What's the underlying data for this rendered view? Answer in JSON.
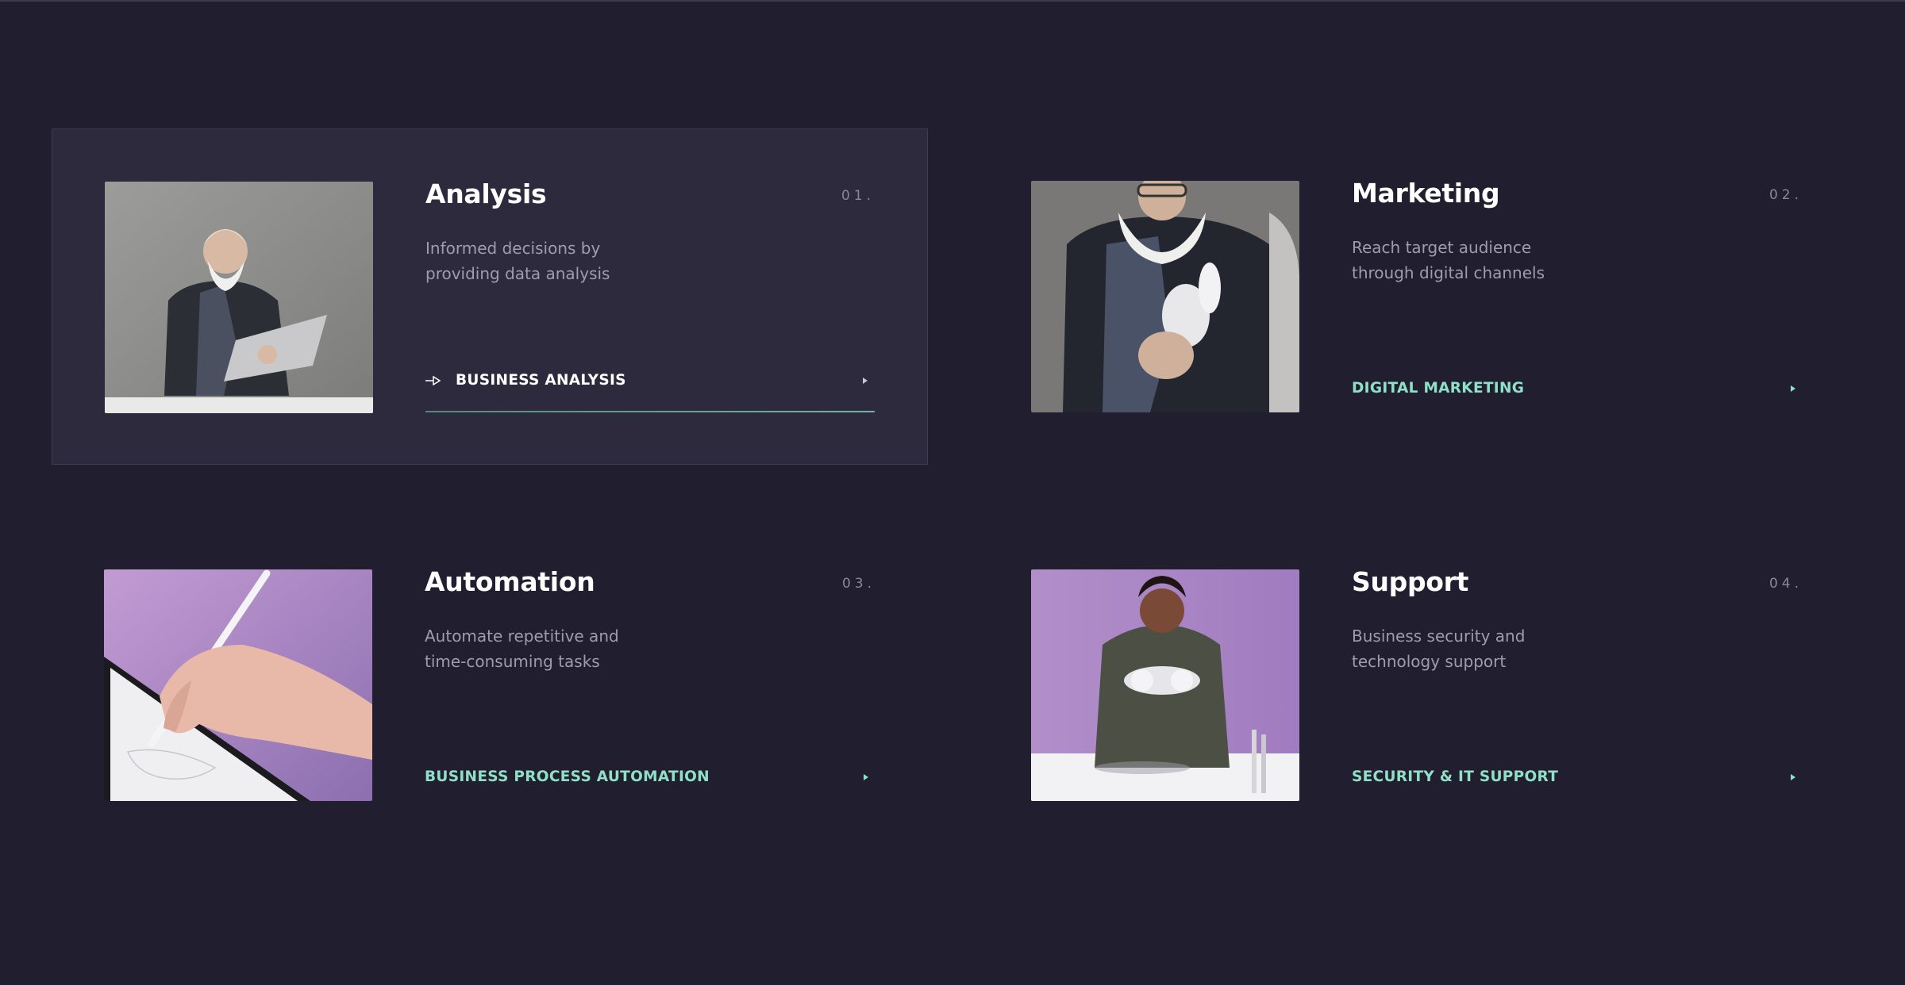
{
  "cards": [
    {
      "title": "Analysis",
      "number": "01.",
      "desc_line1": "Informed decisions by",
      "desc_line2": "providing data analysis",
      "link": "BUSINESS ANALYSIS",
      "photo": "man-with-tablet-photo"
    },
    {
      "title": "Marketing",
      "number": "02.",
      "desc_line1": "Reach target audience",
      "desc_line2": "through digital channels",
      "link": "DIGITAL MARKETING",
      "photo": "man-with-headphones-photo"
    },
    {
      "title": "Automation",
      "number": "03.",
      "desc_line1": "Automate repetitive and",
      "desc_line2": "time-consuming tasks",
      "link": "BUSINESS PROCESS AUTOMATION",
      "photo": "hand-with-stylus-photo"
    },
    {
      "title": "Support",
      "number": "04.",
      "desc_line1": "Business security and",
      "desc_line2": "technology support",
      "link": "SECURITY & IT SUPPORT",
      "photo": "woman-with-headphones-photo"
    }
  ],
  "colors": {
    "background": "#201e2f",
    "card_active": "#2d2a3d",
    "accent": "#8fe0c7",
    "title": "#ffffff",
    "muted": "#9f9cad"
  },
  "icons": {
    "link_arrow": "arrow-right-icon",
    "caret": "caret-right-icon"
  }
}
